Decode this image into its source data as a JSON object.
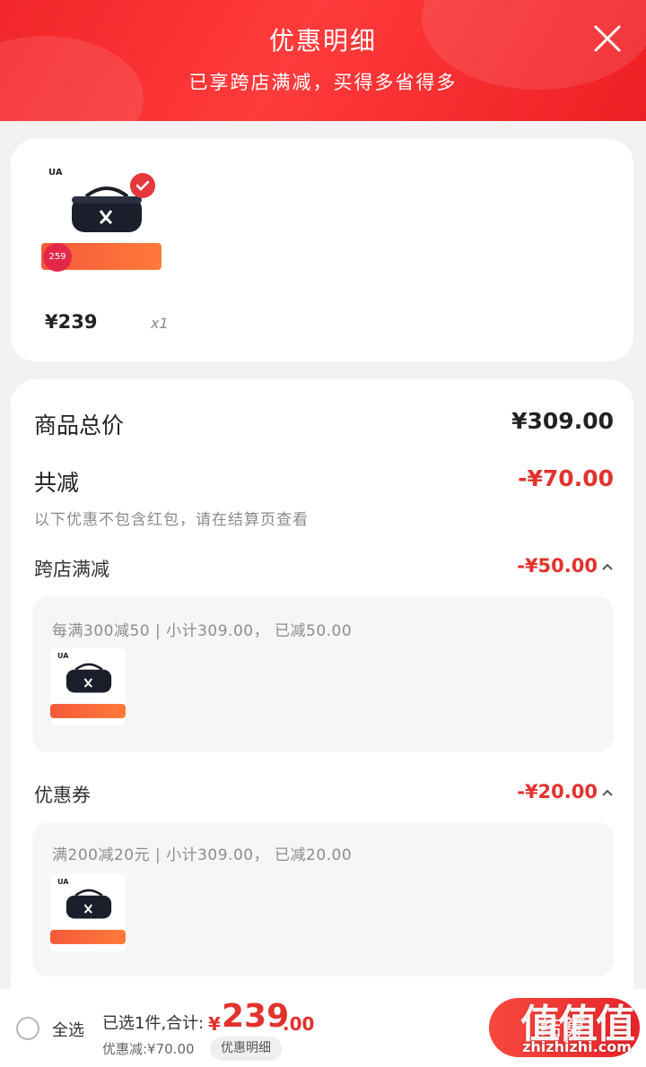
{
  "header": {
    "title": "优惠明细",
    "subtitle": "已享跨店满减，买得多省得多"
  },
  "product": {
    "brand_mark": "UA",
    "promo_tag": "259",
    "price": "¥239",
    "quantity": "x1"
  },
  "summary": {
    "total_label": "商品总价",
    "total_value": "¥309.00",
    "reduce_label": "共减",
    "reduce_value": "-¥70.00",
    "note": "以下优惠不包含红包，请在结算页查看"
  },
  "cross_store": {
    "label": "跨店满减",
    "value": "-¥50.00",
    "detail": "每满300减50 | 小计309.00， 已减50.00"
  },
  "coupon": {
    "label": "优惠券",
    "value": "-¥20.00",
    "detail": "满200减20元 | 小计309.00， 已减20.00"
  },
  "bottom": {
    "select_all": "全选",
    "selected_info": "已选1件,合计:",
    "total_symbol": "¥",
    "total_int": "239",
    "total_dec": ".00",
    "discount_line": "优惠减:¥70.00",
    "detail_chip": "优惠明细",
    "settle_button": "结算",
    "watermark_url": "zhizhizhi.com"
  },
  "colors": {
    "header_red": "#f2262a",
    "price_red": "#e3322d"
  },
  "icons": [
    "close-icon",
    "check-icon",
    "chevron-up-icon",
    "bag-icon"
  ]
}
